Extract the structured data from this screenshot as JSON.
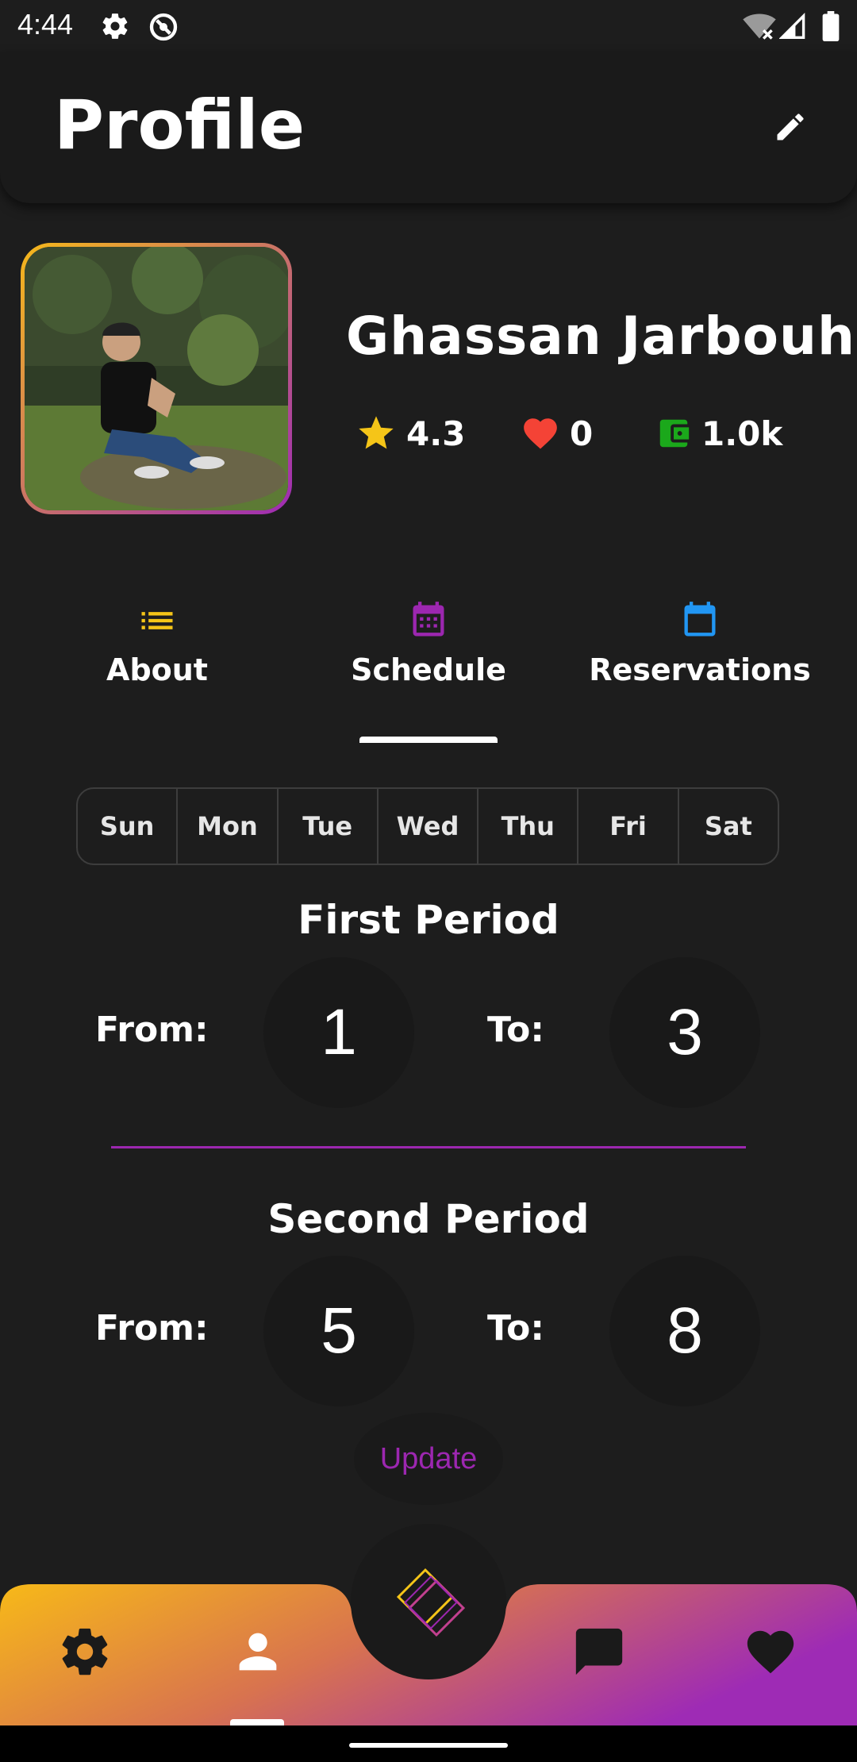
{
  "status_bar": {
    "time": "4:44"
  },
  "header": {
    "title": "Profile"
  },
  "profile": {
    "name": "Ghassan Jarbouh",
    "rating": "4.3",
    "likes": "0",
    "balance": "1.0k"
  },
  "tabs": [
    {
      "label": "About",
      "icon": "list-icon",
      "color": "#f5c518",
      "active": false
    },
    {
      "label": "Schedule",
      "icon": "calendar-icon",
      "color": "#9c27b0",
      "active": true
    },
    {
      "label": "Reservations",
      "icon": "calendar-outline-icon",
      "color": "#2196f3",
      "active": false
    }
  ],
  "days": [
    "Sun",
    "Mon",
    "Tue",
    "Wed",
    "Thu",
    "Fri",
    "Sat"
  ],
  "periods": {
    "first": {
      "title": "First Period",
      "from_label": "From:",
      "from": "1",
      "to_label": "To:",
      "to": "3"
    },
    "second": {
      "title": "Second Period",
      "from_label": "From:",
      "from": "5",
      "to_label": "To:",
      "to": "8"
    }
  },
  "update_label": "Update",
  "nav": {
    "items": [
      "settings-icon",
      "person-icon",
      "chat-icon",
      "heart-icon"
    ],
    "active": "person-icon",
    "gradient": [
      "#f7b918",
      "#9e2bb5"
    ]
  },
  "colors": {
    "background": "#1d1d1d",
    "accent": "#9c27b0",
    "star": "#f5c518",
    "heart": "#f44336",
    "wallet": "#1ba81b"
  }
}
